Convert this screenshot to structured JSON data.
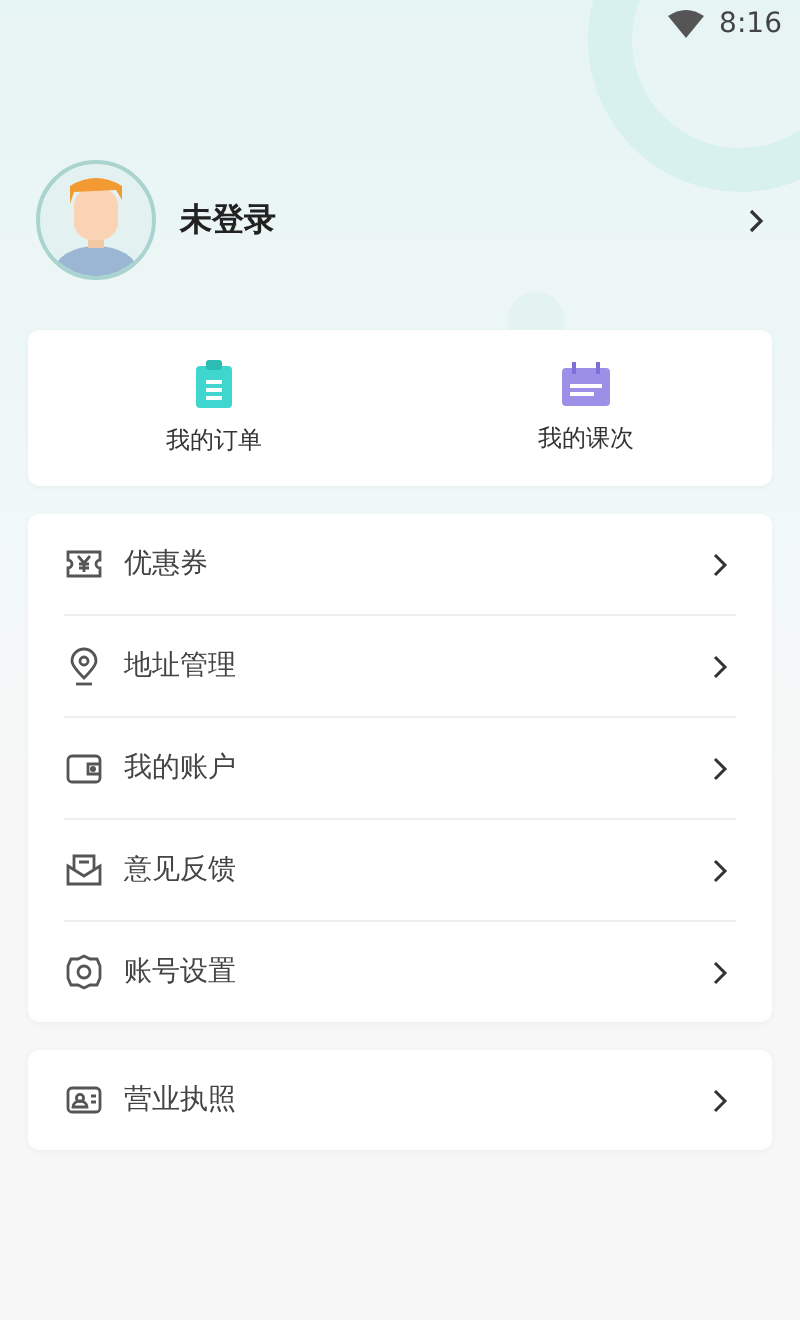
{
  "status_bar": {
    "time": "8:16"
  },
  "profile": {
    "name": "未登录"
  },
  "shortcuts": [
    {
      "label": "我的订单",
      "kind": "order"
    },
    {
      "label": "我的课次",
      "kind": "lesson"
    }
  ],
  "menu": [
    {
      "label": "优惠券",
      "kind": "coupon"
    },
    {
      "label": "地址管理",
      "kind": "location"
    },
    {
      "label": "我的账户",
      "kind": "wallet"
    },
    {
      "label": "意见反馈",
      "kind": "feedback"
    },
    {
      "label": "账号设置",
      "kind": "settings"
    }
  ],
  "menu_2": [
    {
      "label": "营业执照",
      "kind": "license"
    }
  ]
}
